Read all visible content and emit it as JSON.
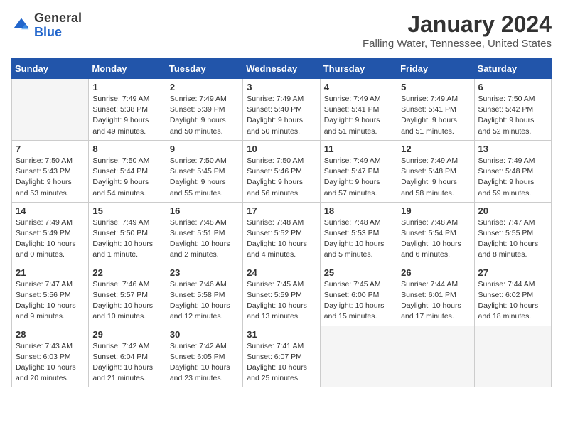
{
  "header": {
    "logo_general": "General",
    "logo_blue": "Blue",
    "month_title": "January 2024",
    "location": "Falling Water, Tennessee, United States"
  },
  "weekdays": [
    "Sunday",
    "Monday",
    "Tuesday",
    "Wednesday",
    "Thursday",
    "Friday",
    "Saturday"
  ],
  "weeks": [
    [
      {
        "day": "",
        "sunrise": "",
        "sunset": "",
        "daylight": "",
        "empty": true
      },
      {
        "day": "1",
        "sunrise": "Sunrise: 7:49 AM",
        "sunset": "Sunset: 5:38 PM",
        "daylight": "Daylight: 9 hours and 49 minutes."
      },
      {
        "day": "2",
        "sunrise": "Sunrise: 7:49 AM",
        "sunset": "Sunset: 5:39 PM",
        "daylight": "Daylight: 9 hours and 50 minutes."
      },
      {
        "day": "3",
        "sunrise": "Sunrise: 7:49 AM",
        "sunset": "Sunset: 5:40 PM",
        "daylight": "Daylight: 9 hours and 50 minutes."
      },
      {
        "day": "4",
        "sunrise": "Sunrise: 7:49 AM",
        "sunset": "Sunset: 5:41 PM",
        "daylight": "Daylight: 9 hours and 51 minutes."
      },
      {
        "day": "5",
        "sunrise": "Sunrise: 7:49 AM",
        "sunset": "Sunset: 5:41 PM",
        "daylight": "Daylight: 9 hours and 51 minutes."
      },
      {
        "day": "6",
        "sunrise": "Sunrise: 7:50 AM",
        "sunset": "Sunset: 5:42 PM",
        "daylight": "Daylight: 9 hours and 52 minutes."
      }
    ],
    [
      {
        "day": "7",
        "sunrise": "Sunrise: 7:50 AM",
        "sunset": "Sunset: 5:43 PM",
        "daylight": "Daylight: 9 hours and 53 minutes."
      },
      {
        "day": "8",
        "sunrise": "Sunrise: 7:50 AM",
        "sunset": "Sunset: 5:44 PM",
        "daylight": "Daylight: 9 hours and 54 minutes."
      },
      {
        "day": "9",
        "sunrise": "Sunrise: 7:50 AM",
        "sunset": "Sunset: 5:45 PM",
        "daylight": "Daylight: 9 hours and 55 minutes."
      },
      {
        "day": "10",
        "sunrise": "Sunrise: 7:50 AM",
        "sunset": "Sunset: 5:46 PM",
        "daylight": "Daylight: 9 hours and 56 minutes."
      },
      {
        "day": "11",
        "sunrise": "Sunrise: 7:49 AM",
        "sunset": "Sunset: 5:47 PM",
        "daylight": "Daylight: 9 hours and 57 minutes."
      },
      {
        "day": "12",
        "sunrise": "Sunrise: 7:49 AM",
        "sunset": "Sunset: 5:48 PM",
        "daylight": "Daylight: 9 hours and 58 minutes."
      },
      {
        "day": "13",
        "sunrise": "Sunrise: 7:49 AM",
        "sunset": "Sunset: 5:48 PM",
        "daylight": "Daylight: 9 hours and 59 minutes."
      }
    ],
    [
      {
        "day": "14",
        "sunrise": "Sunrise: 7:49 AM",
        "sunset": "Sunset: 5:49 PM",
        "daylight": "Daylight: 10 hours and 0 minutes."
      },
      {
        "day": "15",
        "sunrise": "Sunrise: 7:49 AM",
        "sunset": "Sunset: 5:50 PM",
        "daylight": "Daylight: 10 hours and 1 minute."
      },
      {
        "day": "16",
        "sunrise": "Sunrise: 7:48 AM",
        "sunset": "Sunset: 5:51 PM",
        "daylight": "Daylight: 10 hours and 2 minutes."
      },
      {
        "day": "17",
        "sunrise": "Sunrise: 7:48 AM",
        "sunset": "Sunset: 5:52 PM",
        "daylight": "Daylight: 10 hours and 4 minutes."
      },
      {
        "day": "18",
        "sunrise": "Sunrise: 7:48 AM",
        "sunset": "Sunset: 5:53 PM",
        "daylight": "Daylight: 10 hours and 5 minutes."
      },
      {
        "day": "19",
        "sunrise": "Sunrise: 7:48 AM",
        "sunset": "Sunset: 5:54 PM",
        "daylight": "Daylight: 10 hours and 6 minutes."
      },
      {
        "day": "20",
        "sunrise": "Sunrise: 7:47 AM",
        "sunset": "Sunset: 5:55 PM",
        "daylight": "Daylight: 10 hours and 8 minutes."
      }
    ],
    [
      {
        "day": "21",
        "sunrise": "Sunrise: 7:47 AM",
        "sunset": "Sunset: 5:56 PM",
        "daylight": "Daylight: 10 hours and 9 minutes."
      },
      {
        "day": "22",
        "sunrise": "Sunrise: 7:46 AM",
        "sunset": "Sunset: 5:57 PM",
        "daylight": "Daylight: 10 hours and 10 minutes."
      },
      {
        "day": "23",
        "sunrise": "Sunrise: 7:46 AM",
        "sunset": "Sunset: 5:58 PM",
        "daylight": "Daylight: 10 hours and 12 minutes."
      },
      {
        "day": "24",
        "sunrise": "Sunrise: 7:45 AM",
        "sunset": "Sunset: 5:59 PM",
        "daylight": "Daylight: 10 hours and 13 minutes."
      },
      {
        "day": "25",
        "sunrise": "Sunrise: 7:45 AM",
        "sunset": "Sunset: 6:00 PM",
        "daylight": "Daylight: 10 hours and 15 minutes."
      },
      {
        "day": "26",
        "sunrise": "Sunrise: 7:44 AM",
        "sunset": "Sunset: 6:01 PM",
        "daylight": "Daylight: 10 hours and 17 minutes."
      },
      {
        "day": "27",
        "sunrise": "Sunrise: 7:44 AM",
        "sunset": "Sunset: 6:02 PM",
        "daylight": "Daylight: 10 hours and 18 minutes."
      }
    ],
    [
      {
        "day": "28",
        "sunrise": "Sunrise: 7:43 AM",
        "sunset": "Sunset: 6:03 PM",
        "daylight": "Daylight: 10 hours and 20 minutes."
      },
      {
        "day": "29",
        "sunrise": "Sunrise: 7:42 AM",
        "sunset": "Sunset: 6:04 PM",
        "daylight": "Daylight: 10 hours and 21 minutes."
      },
      {
        "day": "30",
        "sunrise": "Sunrise: 7:42 AM",
        "sunset": "Sunset: 6:05 PM",
        "daylight": "Daylight: 10 hours and 23 minutes."
      },
      {
        "day": "31",
        "sunrise": "Sunrise: 7:41 AM",
        "sunset": "Sunset: 6:07 PM",
        "daylight": "Daylight: 10 hours and 25 minutes."
      },
      {
        "day": "",
        "sunrise": "",
        "sunset": "",
        "daylight": "",
        "empty": true
      },
      {
        "day": "",
        "sunrise": "",
        "sunset": "",
        "daylight": "",
        "empty": true
      },
      {
        "day": "",
        "sunrise": "",
        "sunset": "",
        "daylight": "",
        "empty": true
      }
    ]
  ]
}
